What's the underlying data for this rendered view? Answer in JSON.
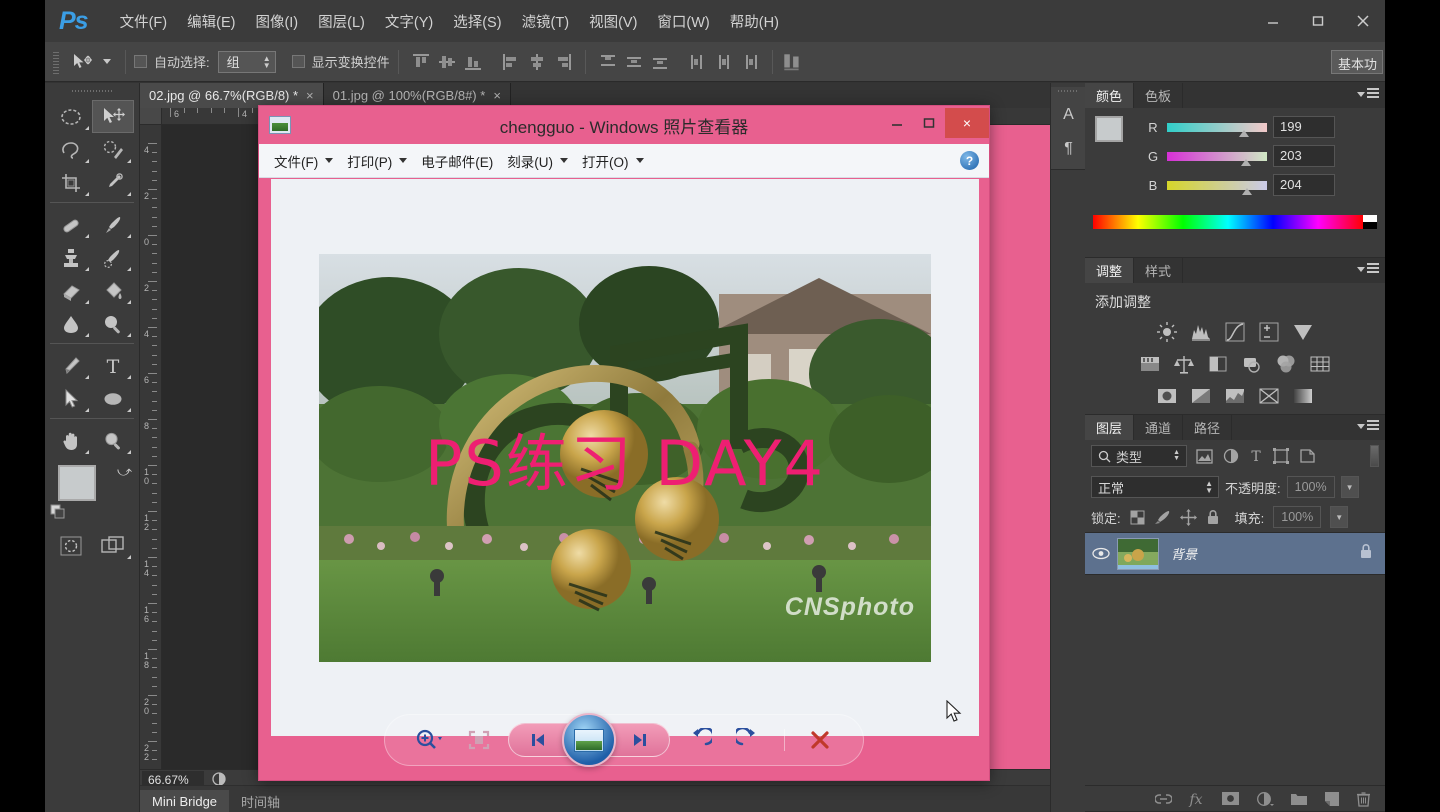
{
  "app": {
    "logo": "Ps",
    "menus": [
      "文件(F)",
      "编辑(E)",
      "图像(I)",
      "图层(L)",
      "文字(Y)",
      "选择(S)",
      "滤镜(T)",
      "视图(V)",
      "窗口(W)",
      "帮助(H)"
    ],
    "window_controls": {
      "minimize": "minimize-icon",
      "maximize": "maximize-icon",
      "close": "close-icon"
    }
  },
  "options_bar": {
    "tool": "move-tool",
    "auto_select_label": "自动选择:",
    "auto_select_value": "组",
    "show_transform_label": "显示变换控件",
    "workspace_button": "基本功"
  },
  "tabs": [
    {
      "label": "02.jpg @ 66.7%(RGB/8) *",
      "close": "×",
      "active": true
    },
    {
      "label": "01.jpg @ 100%(RGB/8#) *",
      "close": "×",
      "active": false
    }
  ],
  "toolbar": {
    "tools": [
      {
        "name": "marquee-tool",
        "selected": false
      },
      {
        "name": "move-tool",
        "selected": true
      },
      {
        "name": "lasso-tool",
        "selected": false
      },
      {
        "name": "quick-selection-tool",
        "selected": false
      },
      {
        "name": "crop-tool",
        "selected": false
      },
      {
        "name": "eyedropper-tool",
        "selected": false
      },
      {
        "name": "healing-brush-tool",
        "selected": false
      },
      {
        "name": "brush-tool",
        "selected": false
      },
      {
        "name": "clone-stamp-tool",
        "selected": false
      },
      {
        "name": "history-brush-tool",
        "selected": false
      },
      {
        "name": "eraser-tool",
        "selected": false
      },
      {
        "name": "paint-bucket-tool",
        "selected": false
      },
      {
        "name": "blur-tool",
        "selected": false
      },
      {
        "name": "dodge-tool",
        "selected": false
      },
      {
        "name": "pen-tool",
        "selected": false
      },
      {
        "name": "type-tool",
        "selected": false
      },
      {
        "name": "path-selection-tool",
        "selected": false
      },
      {
        "name": "ellipse-shape-tool",
        "selected": false
      },
      {
        "name": "hand-tool",
        "selected": false
      },
      {
        "name": "zoom-tool",
        "selected": false
      }
    ],
    "foreground_color": "#c7cbcc",
    "background_color": "#1414e1"
  },
  "rulers": {
    "horizontal_labels": [
      "6",
      "4"
    ],
    "vertical_labels": [
      "4",
      "2",
      "0",
      "2",
      "4",
      "6",
      "8",
      "10",
      "12",
      "14",
      "16",
      "18",
      "20",
      "22"
    ]
  },
  "status_bar": {
    "zoom": "66.67%",
    "bottom_tabs": [
      {
        "label": "Mini Bridge",
        "active": true
      },
      {
        "label": "时间轴",
        "active": false
      }
    ]
  },
  "panels": {
    "mini_dock": [
      {
        "name": "character-panel-icon",
        "glyph": "A"
      },
      {
        "name": "paragraph-panel-icon",
        "glyph": "¶"
      }
    ],
    "color": {
      "tabs": [
        {
          "label": "颜色",
          "active": true
        },
        {
          "label": "色板",
          "active": false
        }
      ],
      "channels": [
        {
          "label": "R",
          "value": "199",
          "pos": 0.775
        },
        {
          "label": "G",
          "value": "203",
          "pos": 0.793
        },
        {
          "label": "B",
          "value": "204",
          "pos": 0.798
        }
      ]
    },
    "adjustments": {
      "tabs": [
        {
          "label": "调整",
          "active": true
        },
        {
          "label": "样式",
          "active": false
        }
      ],
      "title": "添加调整",
      "icons": [
        "brightness-contrast-icon",
        "levels-icon",
        "curves-icon",
        "exposure-icon",
        "vibrance-icon",
        "hue-saturation-icon",
        "color-balance-icon",
        "black-white-icon",
        "photo-filter-icon",
        "channel-mixer-icon",
        "color-lookup-icon",
        "invert-icon",
        "posterize-icon",
        "threshold-icon",
        "selective-color-icon",
        "gradient-map-icon"
      ]
    },
    "layers": {
      "tabs": [
        {
          "label": "图层",
          "active": true
        },
        {
          "label": "通道",
          "active": false
        },
        {
          "label": "路径",
          "active": false
        }
      ],
      "filter_label": "类型",
      "filter_icons": [
        "pixel-filter-icon",
        "adjustment-filter-icon",
        "type-filter-icon",
        "shape-filter-icon",
        "smart-object-filter-icon"
      ],
      "blend_mode": "正常",
      "opacity_label": "不透明度:",
      "opacity_value": "100%",
      "lock_label": "锁定:",
      "fill_label": "填充:",
      "fill_value": "100%",
      "lock_icons": [
        "lock-transparency-icon",
        "lock-image-icon",
        "lock-position-icon",
        "lock-all-icon"
      ],
      "items": [
        {
          "name": "背景",
          "visible": true,
          "locked": true,
          "selected": true
        }
      ],
      "footer_icons": [
        "link-layers-icon",
        "layer-style-fx-icon",
        "add-mask-icon",
        "new-adjustment-icon",
        "new-group-icon",
        "new-layer-icon",
        "delete-layer-icon"
      ]
    }
  },
  "photo_viewer": {
    "title": "chengguo - Windows 照片查看器",
    "window_controls": {
      "minimize": "minimize-icon",
      "maximize": "maximize-icon",
      "close": "×"
    },
    "menus": [
      {
        "label": "文件(F)",
        "has_caret": true
      },
      {
        "label": "打印(P)",
        "has_caret": true
      },
      {
        "label": "电子邮件(E)",
        "has_caret": false
      },
      {
        "label": "刻录(U)",
        "has_caret": true
      },
      {
        "label": "打开(O)",
        "has_caret": true
      }
    ],
    "help_icon": "?",
    "image": {
      "overlay_text": "PS练习 DAY4",
      "overlay_color": "#ee1f72",
      "watermark": "CNSphoto"
    },
    "toolbar": [
      {
        "name": "zoom-button",
        "icon": "magnifier-plus-icon"
      },
      {
        "name": "fit-to-window-button",
        "icon": "fit-screen-icon"
      },
      {
        "name": "previous-button",
        "icon": "previous-icon"
      },
      {
        "name": "slideshow-button",
        "icon": "slideshow-icon"
      },
      {
        "name": "next-button",
        "icon": "next-icon"
      },
      {
        "name": "rotate-left-button",
        "icon": "rotate-ccw-icon"
      },
      {
        "name": "rotate-right-button",
        "icon": "rotate-cw-icon"
      },
      {
        "name": "delete-button",
        "icon": "delete-x-icon"
      }
    ]
  }
}
